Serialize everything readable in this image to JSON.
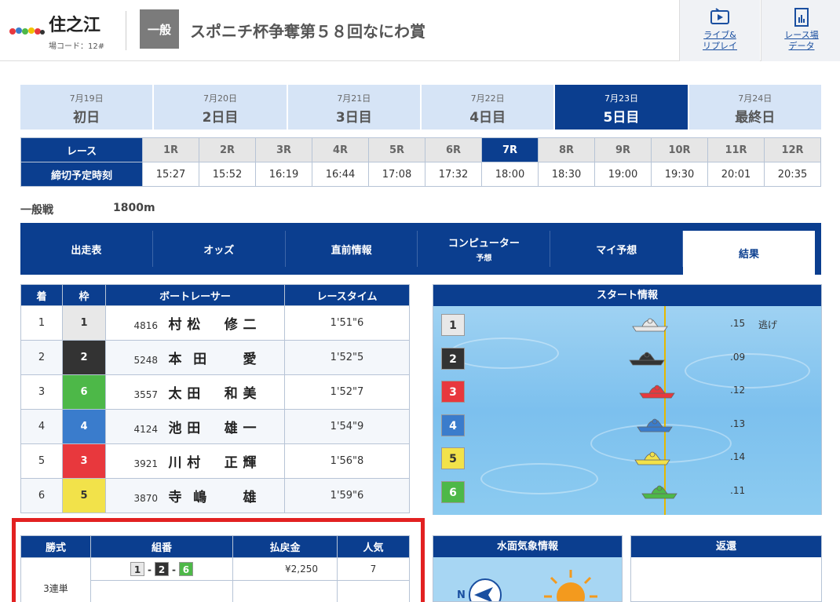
{
  "header": {
    "venue": "住之江",
    "venue_code": "場コード：12#",
    "grade": "一般",
    "race_title": "スポニチ杯争奪第５８回なにわ賞",
    "buttons": [
      {
        "label": "ライブ&\nリプレイ",
        "icon": "tv-icon"
      },
      {
        "label": "レース場\nデータ",
        "icon": "document-chart-icon"
      }
    ]
  },
  "days": [
    {
      "date": "7月19日",
      "name": "初日",
      "active": false
    },
    {
      "date": "7月20日",
      "name": "2日目",
      "active": false
    },
    {
      "date": "7月21日",
      "name": "3日目",
      "active": false
    },
    {
      "date": "7月22日",
      "name": "4日目",
      "active": false
    },
    {
      "date": "7月23日",
      "name": "5日目",
      "active": true
    },
    {
      "date": "7月24日",
      "name": "最終日",
      "active": false
    }
  ],
  "race_table": {
    "race_label": "レース",
    "deadline_label": "締切予定時刻",
    "races": [
      "1R",
      "2R",
      "3R",
      "4R",
      "5R",
      "6R",
      "7R",
      "8R",
      "9R",
      "10R",
      "11R",
      "12R"
    ],
    "times": [
      "15:27",
      "15:52",
      "16:19",
      "16:44",
      "17:08",
      "17:32",
      "18:00",
      "18:30",
      "19:00",
      "19:30",
      "20:01",
      "20:35"
    ],
    "active_index": 6
  },
  "race_info": {
    "class": "一般戦",
    "distance": "1800m"
  },
  "nav": [
    {
      "label": "出走表",
      "sub": ""
    },
    {
      "label": "オッズ",
      "sub": ""
    },
    {
      "label": "直前情報",
      "sub": ""
    },
    {
      "label": "コンピューター",
      "sub": "予想"
    },
    {
      "label": "マイ予想",
      "sub": ""
    },
    {
      "label": "結果",
      "sub": "",
      "active": true
    }
  ],
  "results": {
    "headers": [
      "着",
      "枠",
      "ボートレーサー",
      "レースタイム"
    ],
    "rows": [
      {
        "place": "1",
        "frame": "1",
        "num": "4816",
        "name": "村松　修二",
        "time": "1'51\"6"
      },
      {
        "place": "2",
        "frame": "2",
        "num": "5248",
        "name": "本田　愛",
        "time": "1'52\"5"
      },
      {
        "place": "3",
        "frame": "6",
        "num": "3557",
        "name": "太田　和美",
        "time": "1'52\"7"
      },
      {
        "place": "4",
        "frame": "4",
        "num": "4124",
        "name": "池田　雄一",
        "time": "1'54\"9"
      },
      {
        "place": "5",
        "frame": "3",
        "num": "3921",
        "name": "川村　正輝",
        "time": "1'56\"8"
      },
      {
        "place": "6",
        "frame": "5",
        "num": "3870",
        "name": "寺嶋　雄",
        "time": "1'59\"6"
      }
    ]
  },
  "frame_colors": {
    "1": "#e8e8e8",
    "2": "#333333",
    "3": "#e8383d",
    "4": "#3a7ccc",
    "5": "#f2e24a",
    "6": "#4db848"
  },
  "frame_text_colors": {
    "1": "#333333",
    "2": "#ffffff",
    "3": "#ffffff",
    "4": "#ffffff",
    "5": "#333333",
    "6": "#ffffff"
  },
  "start_info": {
    "title": "スタート情報",
    "lanes": [
      {
        "lane": "1",
        "st": ".15",
        "tactic": "逃げ",
        "offset": 0.15
      },
      {
        "lane": "2",
        "st": ".09",
        "tactic": "",
        "offset": 0.09
      },
      {
        "lane": "3",
        "st": ".12",
        "tactic": "",
        "offset": 0.12
      },
      {
        "lane": "4",
        "st": ".13",
        "tactic": "",
        "offset": 0.13
      },
      {
        "lane": "5",
        "st": ".14",
        "tactic": "",
        "offset": 0.14
      },
      {
        "lane": "6",
        "st": ".11",
        "tactic": "",
        "offset": 0.11
      }
    ]
  },
  "payout": {
    "headers": [
      "勝式",
      "組番",
      "払戻金",
      "人気"
    ],
    "bet_type": "3連単",
    "combo": [
      "1",
      "2",
      "6"
    ],
    "amount": "¥2,250",
    "popularity": "7"
  },
  "weather": {
    "title": "水面気象情報",
    "wind_dir_label": "N"
  },
  "refund": {
    "title": "返還"
  }
}
